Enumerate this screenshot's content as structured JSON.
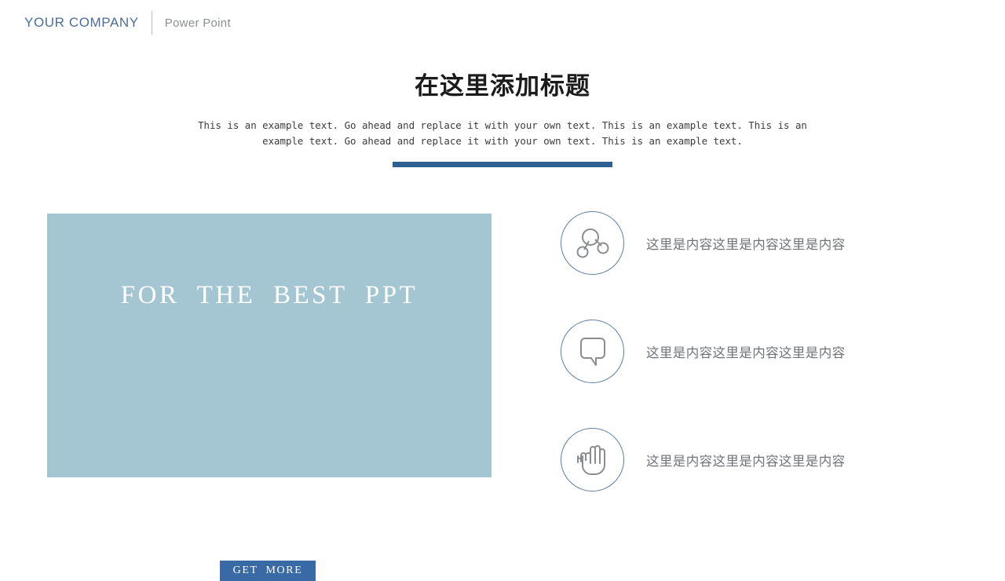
{
  "header": {
    "brand": "YOUR COMPANY",
    "sub_brand": "Power Point",
    "brand_color": "#4a6e96",
    "sub_brand_color": "#8b8f94",
    "divider_color": "#b9bcc0"
  },
  "slide": {
    "title": "在这里添加标题",
    "subtitle": "This is an example text. Go ahead and replace it with your own text. This is an example text. This is an example text. Go ahead and replace it with your own text. This is an example text.",
    "accent_bar_color": "#2e6094"
  },
  "panel": {
    "background_color": "#a4c6d2",
    "headline": "FOR THE BEST PPT",
    "headline_color": "#ffffff",
    "button_label": "GET MORE",
    "button_color": "#3a6aa5",
    "button_text_color": "#ffffff"
  },
  "features": {
    "circle_border_color": "#5c7fa8",
    "icon_stroke_color": "#8a8d8f",
    "text_color": "#6f7377",
    "items": [
      {
        "icon": "network-nodes-icon",
        "text": "这里是内容这里是内容这里是内容"
      },
      {
        "icon": "speech-bubble-icon",
        "text": "这里是内容这里是内容这里是内容"
      },
      {
        "icon": "hand-palm-icon",
        "text": "这里是内容这里是内容这里是内容"
      }
    ]
  }
}
